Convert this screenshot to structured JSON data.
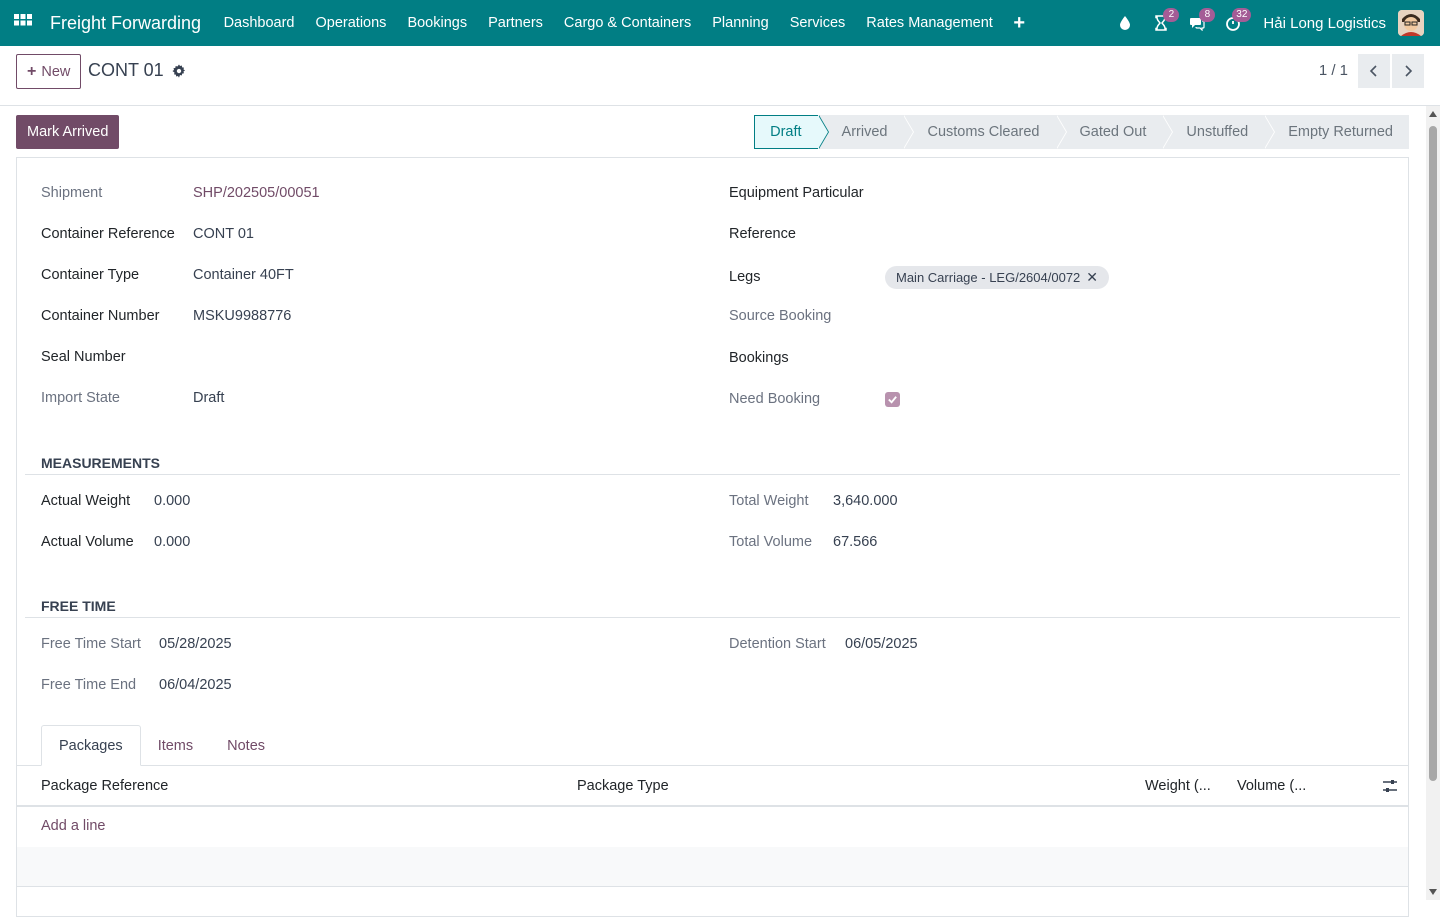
{
  "topbar": {
    "app_name": "Freight Forwarding",
    "menu": [
      "Dashboard",
      "Operations",
      "Bookings",
      "Partners",
      "Cargo & Containers",
      "Planning",
      "Services",
      "Rates Management"
    ],
    "menu_plus": "+",
    "activity_badge": "2",
    "messages_badge": "8",
    "timer_badge": "32",
    "company": "Hải Long Logistics",
    "colors": {
      "bar": "#017e84",
      "badge": "#a45c96"
    }
  },
  "control": {
    "new_label": "New",
    "record_name": "CONT 01",
    "pager": "1 / 1"
  },
  "status": {
    "mark_arrived": "Mark Arrived",
    "stages": [
      "Draft",
      "Arrived",
      "Customs Cleared",
      "Gated Out",
      "Unstuffed",
      "Empty Returned"
    ],
    "active_stage": "Draft"
  },
  "form": {
    "left": {
      "shipment_label": "Shipment",
      "shipment_value": "SHP/202505/00051",
      "container_ref_label": "Container Reference",
      "container_ref_value": "CONT 01",
      "container_type_label": "Container Type",
      "container_type_value": "Container 40FT",
      "container_number_label": "Container Number",
      "container_number_value": "MSKU9988776",
      "seal_number_label": "Seal Number",
      "seal_number_value": "",
      "import_state_label": "Import State",
      "import_state_value": "Draft"
    },
    "right": {
      "equipment_label": "Equipment Particular",
      "reference_label": "Reference",
      "legs_label": "Legs",
      "legs_tag": "Main Carriage - LEG/2604/0072",
      "source_booking_label": "Source Booking",
      "bookings_label": "Bookings",
      "need_booking_label": "Need Booking",
      "need_booking_checked": true
    },
    "measurements": {
      "title": "MEASUREMENTS",
      "actual_weight_label": "Actual Weight",
      "actual_weight_value": "0.000",
      "actual_volume_label": "Actual Volume",
      "actual_volume_value": "0.000",
      "total_weight_label": "Total Weight",
      "total_weight_value": "3,640.000",
      "total_volume_label": "Total Volume",
      "total_volume_value": "67.566"
    },
    "free_time": {
      "title": "FREE TIME",
      "start_label": "Free Time Start",
      "start_value": "05/28/2025",
      "end_label": "Free Time End",
      "end_value": "06/04/2025",
      "detention_label": "Detention Start",
      "detention_value": "06/05/2025"
    }
  },
  "tabs": [
    "Packages",
    "Items",
    "Notes"
  ],
  "packages_table": {
    "columns": [
      "Package Reference",
      "Package Type",
      "Weight (...",
      "Volume (..."
    ],
    "add_line": "Add a line"
  }
}
